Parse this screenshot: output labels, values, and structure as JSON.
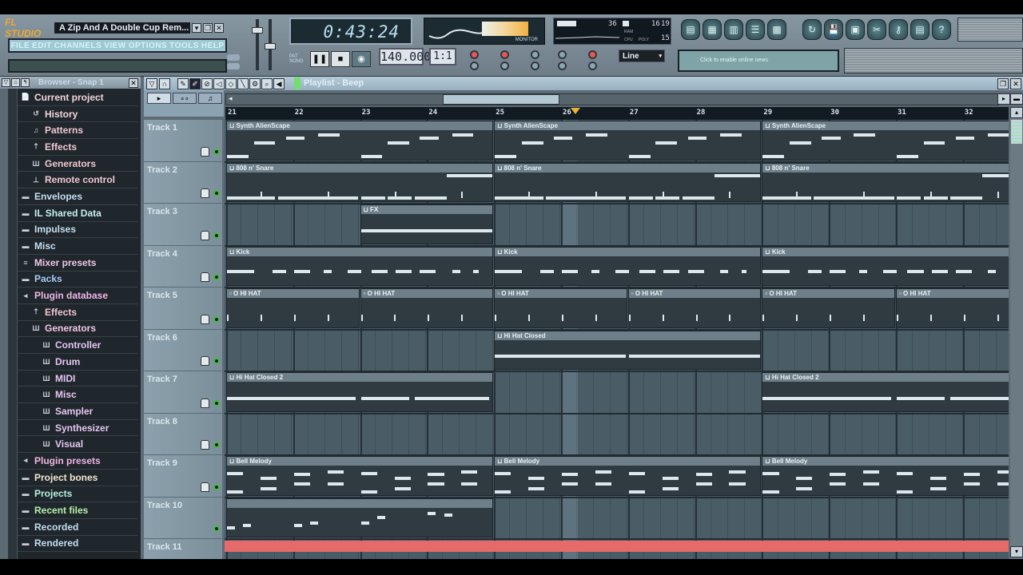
{
  "app": {
    "logo": "FL STUDIO",
    "song_title": "A Zip And A Double Cup Rem...",
    "menu": [
      "FILE",
      "EDIT",
      "CHANNELS",
      "VIEW",
      "OPTIONS",
      "TOOLS",
      "HELP"
    ]
  },
  "transport": {
    "time": "0:43:24",
    "tempo": "140.000",
    "step": "1:1",
    "pat_label": "PAT",
    "song_label": "SONG",
    "pause_icon": "pause-icon",
    "stop_icon": "stop-icon",
    "record_icon": "record-icon"
  },
  "monitor": {
    "label": "MONITOR"
  },
  "cpu_panel": {
    "value_top": "36",
    "ram_label": "RAM",
    "cpu_label": "CPU",
    "poly_label": "POLY",
    "val1": "16",
    "val2": "19",
    "poly": "15"
  },
  "snap_select": "Line",
  "news_text": "Click to enable online news",
  "toolbar_icons": [
    "playlist-icon",
    "step-sequencer-icon",
    "piano-roll-icon",
    "browser-icon",
    "mixer-icon",
    "undo-icon",
    "save-icon",
    "export-icon",
    "cut-icon",
    "settings-icon",
    "project-info-icon",
    "help-icon"
  ],
  "browser": {
    "title": "Browser - Snap 1",
    "items": [
      {
        "label": "Current project",
        "icon": "📄",
        "color": "#f3d6da",
        "indent": 0
      },
      {
        "label": "History",
        "icon": "↺",
        "color": "#f3d6da",
        "indent": 1
      },
      {
        "label": "Patterns",
        "icon": "♫",
        "color": "#f0c6d0",
        "indent": 1
      },
      {
        "label": "Effects",
        "icon": "⇡",
        "color": "#f0c6d0",
        "indent": 1
      },
      {
        "label": "Generators",
        "icon": "Ш",
        "color": "#f0c6d0",
        "indent": 1
      },
      {
        "label": "Remote control",
        "icon": "⊥",
        "color": "#f0c6d0",
        "indent": 1
      },
      {
        "label": "Envelopes",
        "icon": "▬",
        "color": "#c6dff0",
        "indent": 0
      },
      {
        "label": "IL Shared Data",
        "icon": "▬",
        "color": "#c6f0ec",
        "indent": 0
      },
      {
        "label": "Impulses",
        "icon": "▬",
        "color": "#c6dff0",
        "indent": 0
      },
      {
        "label": "Misc",
        "icon": "▬",
        "color": "#c6dff0",
        "indent": 0
      },
      {
        "label": "Mixer presets",
        "icon": "≡",
        "color": "#f0c6e6",
        "indent": 0
      },
      {
        "label": "Packs",
        "icon": "▬",
        "color": "#a9c9f0",
        "indent": 0
      },
      {
        "label": "Plugin database",
        "icon": "◂",
        "color": "#f0b6e6",
        "indent": 0
      },
      {
        "label": "Effects",
        "icon": "⇡",
        "color": "#f0c6d0",
        "indent": 1
      },
      {
        "label": "Generators",
        "icon": "Ш",
        "color": "#f0c6e6",
        "indent": 1
      },
      {
        "label": "Controller",
        "icon": "Ш",
        "color": "#e6c6f0",
        "indent": 2
      },
      {
        "label": "Drum",
        "icon": "Ш",
        "color": "#e6c6f0",
        "indent": 2
      },
      {
        "label": "MIDI",
        "icon": "Ш",
        "color": "#e6c6f0",
        "indent": 2
      },
      {
        "label": "Misc",
        "icon": "Ш",
        "color": "#e6c6f0",
        "indent": 2
      },
      {
        "label": "Sampler",
        "icon": "Ш",
        "color": "#e6c6f0",
        "indent": 2
      },
      {
        "label": "Synthesizer",
        "icon": "Ш",
        "color": "#e6c6f0",
        "indent": 2
      },
      {
        "label": "Visual",
        "icon": "Ш",
        "color": "#e6c6f0",
        "indent": 2
      },
      {
        "label": "Plugin presets",
        "icon": "◂",
        "color": "#f0b6e6",
        "indent": 0
      },
      {
        "label": "Project bones",
        "icon": "▬",
        "color": "#f3e6d0",
        "indent": 0
      },
      {
        "label": "Projects",
        "icon": "▬",
        "color": "#b6f0e0",
        "indent": 0
      },
      {
        "label": "Recent files",
        "icon": "▬",
        "color": "#b6f0a9",
        "indent": 0
      },
      {
        "label": "Recorded",
        "icon": "▬",
        "color": "#c6dff0",
        "indent": 0
      },
      {
        "label": "Rendered",
        "icon": "▬",
        "color": "#c6dff0",
        "indent": 0
      }
    ]
  },
  "playlist": {
    "title": "Playlist - Beep",
    "ruler": [
      "21",
      "22",
      "23",
      "24",
      "25",
      "26",
      "27",
      "28",
      "29",
      "30",
      "31",
      "32"
    ],
    "tracks": [
      "Track 1",
      "Track 2",
      "Track 3",
      "Track 4",
      "Track 5",
      "Track 6",
      "Track 7",
      "Track 8",
      "Track 9",
      "Track 10",
      "Track 11"
    ],
    "clips": [
      {
        "track": 0,
        "start": 21,
        "len": 4,
        "name": "Synth AlienScape"
      },
      {
        "track": 0,
        "start": 25,
        "len": 4,
        "name": "Synth AlienScape"
      },
      {
        "track": 0,
        "start": 29,
        "len": 4,
        "name": "Synth AlienScape"
      },
      {
        "track": 1,
        "start": 21,
        "len": 4,
        "name": "808 n' Snare"
      },
      {
        "track": 1,
        "start": 25,
        "len": 4,
        "name": "808 n' Snare"
      },
      {
        "track": 1,
        "start": 29,
        "len": 4,
        "name": "808 n' Snare"
      },
      {
        "track": 2,
        "start": 23,
        "len": 2,
        "name": "FX"
      },
      {
        "track": 3,
        "start": 21,
        "len": 4,
        "name": "Kick"
      },
      {
        "track": 3,
        "start": 25,
        "len": 4,
        "name": "Kick"
      },
      {
        "track": 3,
        "start": 29,
        "len": 4,
        "name": "Kick"
      },
      {
        "track": 4,
        "start": 21,
        "len": 2,
        "name": "O HI HAT"
      },
      {
        "track": 4,
        "start": 23,
        "len": 2,
        "name": "O HI HAT"
      },
      {
        "track": 4,
        "start": 25,
        "len": 2,
        "name": "O HI HAT"
      },
      {
        "track": 4,
        "start": 27,
        "len": 2,
        "name": "O HI HAT"
      },
      {
        "track": 4,
        "start": 29,
        "len": 2,
        "name": "O HI HAT"
      },
      {
        "track": 4,
        "start": 31,
        "len": 2,
        "name": "O HI HAT"
      },
      {
        "track": 5,
        "start": 25,
        "len": 4,
        "name": "Hi Hat Closed"
      },
      {
        "track": 6,
        "start": 21,
        "len": 4,
        "name": "Hi Hat Closed 2"
      },
      {
        "track": 6,
        "start": 29,
        "len": 4,
        "name": "Hi Hat Closed 2"
      },
      {
        "track": 8,
        "start": 21,
        "len": 4,
        "name": "Bell Melody"
      },
      {
        "track": 8,
        "start": 25,
        "len": 4,
        "name": "Bell Melody"
      },
      {
        "track": 8,
        "start": 29,
        "len": 4,
        "name": "Bell Melody"
      },
      {
        "track": 9,
        "start": 21,
        "len": 4,
        "name": ""
      }
    ],
    "playhead_bar": 26.2,
    "scroll_position": 0.28
  }
}
